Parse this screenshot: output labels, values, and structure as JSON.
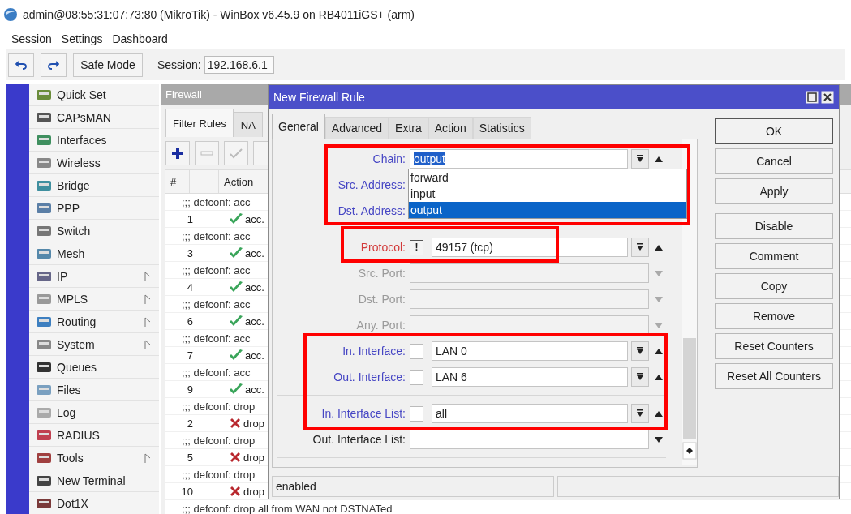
{
  "window": {
    "title": "admin@08:55:31:07:73:80 (MikroTik) - WinBox v6.45.9 on RB4011iGS+ (arm)"
  },
  "menu": [
    "Session",
    "Settings",
    "Dashboard"
  ],
  "toolbar": {
    "safe_mode": "Safe Mode",
    "session_label": "Session:",
    "session_value": "192.168.6.1"
  },
  "sidebar": [
    {
      "label": "Quick Set",
      "submenu": false
    },
    {
      "label": "CAPsMAN",
      "submenu": false
    },
    {
      "label": "Interfaces",
      "submenu": false
    },
    {
      "label": "Wireless",
      "submenu": false
    },
    {
      "label": "Bridge",
      "submenu": false
    },
    {
      "label": "PPP",
      "submenu": false
    },
    {
      "label": "Switch",
      "submenu": false
    },
    {
      "label": "Mesh",
      "submenu": false
    },
    {
      "label": "IP",
      "submenu": true
    },
    {
      "label": "MPLS",
      "submenu": true
    },
    {
      "label": "Routing",
      "submenu": true
    },
    {
      "label": "System",
      "submenu": true
    },
    {
      "label": "Queues",
      "submenu": false
    },
    {
      "label": "Files",
      "submenu": false
    },
    {
      "label": "Log",
      "submenu": false
    },
    {
      "label": "RADIUS",
      "submenu": false
    },
    {
      "label": "Tools",
      "submenu": true
    },
    {
      "label": "New Terminal",
      "submenu": false
    },
    {
      "label": "Dot1X",
      "submenu": false
    }
  ],
  "firewall": {
    "title": "Firewall",
    "tabs": [
      {
        "label": "Filter Rules",
        "selected": true
      },
      {
        "label": "NA",
        "selected": false
      }
    ],
    "columns": [
      "#",
      "Action"
    ],
    "rows": [
      {
        "kind": "comment",
        "text": ";;; defconf: acc"
      },
      {
        "kind": "accept",
        "number": "1",
        "text": "acc."
      },
      {
        "kind": "comment",
        "text": ";;; defconf: acc"
      },
      {
        "kind": "accept",
        "number": "3",
        "text": "acc."
      },
      {
        "kind": "comment",
        "text": ";;; defconf: acc"
      },
      {
        "kind": "accept",
        "number": "4",
        "text": "acc."
      },
      {
        "kind": "comment",
        "text": ";;; defconf: acc"
      },
      {
        "kind": "accept",
        "number": "6",
        "text": "acc."
      },
      {
        "kind": "comment",
        "text": ";;; defconf: acc"
      },
      {
        "kind": "accept",
        "number": "7",
        "text": "acc."
      },
      {
        "kind": "comment",
        "text": ";;; defconf: acc"
      },
      {
        "kind": "accept",
        "number": "9",
        "text": "acc."
      },
      {
        "kind": "comment",
        "text": ";;; defconf: drop"
      },
      {
        "kind": "drop",
        "number": "2",
        "text": "drop"
      },
      {
        "kind": "comment",
        "text": ";;; defconf: drop"
      },
      {
        "kind": "drop",
        "number": "5",
        "text": "drop"
      },
      {
        "kind": "comment",
        "text": ";;; defconf: drop"
      },
      {
        "kind": "drop",
        "number": "10",
        "text": "drop"
      },
      {
        "kind": "comment",
        "text": ";;; defconf: drop all from WAN not DSTNATed"
      }
    ]
  },
  "dialog": {
    "title": "New Firewall Rule",
    "tabs": [
      {
        "label": "General",
        "selected": true
      },
      {
        "label": "Advanced",
        "selected": false
      },
      {
        "label": "Extra",
        "selected": false
      },
      {
        "label": "Action",
        "selected": false
      },
      {
        "label": "Statistics",
        "selected": false
      }
    ],
    "fields": [
      {
        "label": "Chain:",
        "kind": "select",
        "value": "output",
        "text_selected": true,
        "highlighted": true,
        "disabled": false,
        "divider_after": false,
        "open": true,
        "options": [
          {
            "label": "forward",
            "selected": false
          },
          {
            "label": "input",
            "selected": false
          },
          {
            "label": "output",
            "selected": true
          }
        ]
      },
      {
        "label": "Src. Address:",
        "kind": "text",
        "highlighted": true,
        "disabled": false,
        "divider_after": false
      },
      {
        "label": "Dst. Address:",
        "kind": "text",
        "highlighted": true,
        "disabled": false,
        "divider_after": true
      },
      {
        "label": "Protocol:",
        "kind": "select",
        "value": "49157 (tcp)",
        "negate": true,
        "negate_mark": "!",
        "disabled": false,
        "divider_after": false
      },
      {
        "label": "Src. Port:",
        "kind": "text",
        "disabled": true,
        "divider_after": false
      },
      {
        "label": "Dst. Port:",
        "kind": "text",
        "disabled": true,
        "divider_after": false
      },
      {
        "label": "Any. Port:",
        "kind": "text",
        "disabled": true,
        "divider_after": false
      },
      {
        "label": "In. Interface:",
        "kind": "select",
        "value": "LAN 0",
        "negate": false,
        "highlighted": true,
        "disabled": false,
        "divider_after": false
      },
      {
        "label": "Out. Interface:",
        "kind": "select",
        "value": "LAN 6",
        "negate": false,
        "highlighted": true,
        "disabled": false,
        "divider_after": true
      },
      {
        "label": "In. Interface List:",
        "kind": "select",
        "value": "all",
        "negate": false,
        "highlighted": true,
        "disabled": false,
        "divider_after": false
      },
      {
        "label": "Out. Interface List:",
        "kind": "text",
        "highlighted": false,
        "disabled": false,
        "divider_after": true
      }
    ],
    "button_groups": [
      [
        {
          "label": "OK",
          "default": true
        },
        {
          "label": "Cancel",
          "default": false
        },
        {
          "label": "Apply",
          "default": false
        }
      ],
      [
        {
          "label": "Disable",
          "default": false
        },
        {
          "label": "Comment",
          "default": false
        },
        {
          "label": "Copy",
          "default": false
        },
        {
          "label": "Remove",
          "default": false
        },
        {
          "label": "Reset Counters",
          "default": false
        },
        {
          "label": "Reset All Counters",
          "default": false
        }
      ]
    ],
    "status_bar": {
      "text": "enabled"
    }
  }
}
